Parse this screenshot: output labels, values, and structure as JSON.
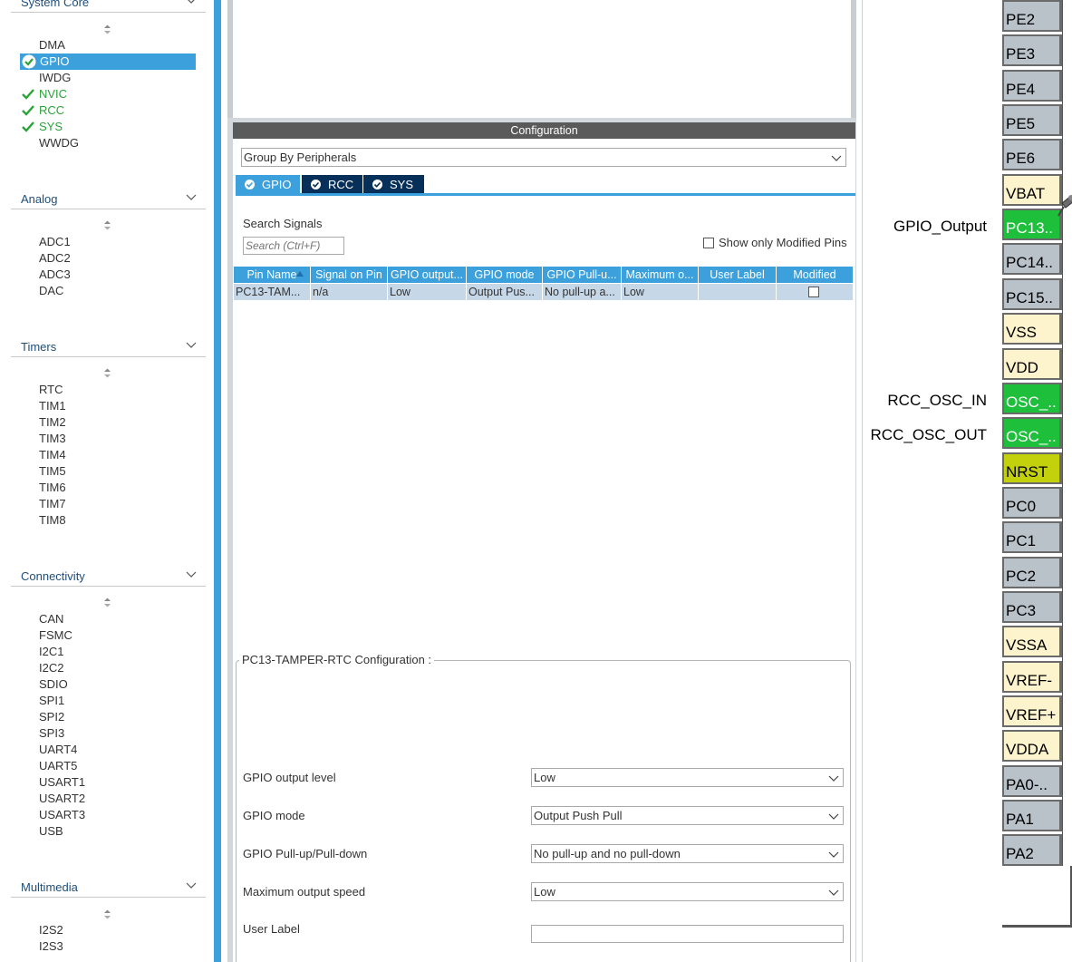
{
  "sidebar": {
    "categories": [
      {
        "title": "System Core",
        "items": [
          "DMA",
          "GPIO",
          "IWDG",
          "NVIC",
          "RCC",
          "SYS",
          "WWDG"
        ]
      },
      {
        "title": "Analog",
        "items": [
          "ADC1",
          "ADC2",
          "ADC3",
          "DAC"
        ]
      },
      {
        "title": "Timers",
        "items": [
          "RTC",
          "TIM1",
          "TIM2",
          "TIM3",
          "TIM4",
          "TIM5",
          "TIM6",
          "TIM7",
          "TIM8"
        ]
      },
      {
        "title": "Connectivity",
        "items": [
          "CAN",
          "FSMC",
          "I2C1",
          "I2C2",
          "SDIO",
          "SPI1",
          "SPI2",
          "SPI3",
          "UART4",
          "UART5",
          "USART1",
          "USART2",
          "USART3",
          "USB"
        ]
      },
      {
        "title": "Multimedia",
        "items": [
          "I2S2",
          "I2S3"
        ]
      }
    ],
    "selected_item": "GPIO",
    "checked_items": [
      "NVIC",
      "RCC",
      "SYS"
    ],
    "colors": {
      "accent": "#3ca0dc",
      "checked": "#2aa33a"
    }
  },
  "config": {
    "title": "Configuration",
    "group_by": "Group By Peripherals",
    "tabs": [
      {
        "label": "GPIO",
        "active": true
      },
      {
        "label": "RCC",
        "active": false
      },
      {
        "label": "SYS",
        "active": false
      }
    ],
    "search_label": "Search Signals",
    "search_placeholder": "Search (Ctrl+F)",
    "show_modified_label": "Show only Modified Pins",
    "table": {
      "headers": [
        "Pin Name",
        "Signal on Pin",
        "GPIO output...",
        "GPIO mode",
        "GPIO Pull-u...",
        "Maximum o...",
        "User Label",
        "Modified"
      ],
      "rows": [
        [
          "PC13-TAM...",
          "n/a",
          "Low",
          "Output Pus...",
          "No pull-up a...",
          "Low",
          "",
          ""
        ]
      ]
    },
    "pin_config": {
      "title": "PC13-TAMPER-RTC Configuration :",
      "fields": [
        {
          "label": "GPIO output level",
          "value": "Low"
        },
        {
          "label": "GPIO mode",
          "value": "Output Push Pull"
        },
        {
          "label": "GPIO Pull-up/Pull-down",
          "value": "No pull-up and no pull-down"
        },
        {
          "label": "Maximum output speed",
          "value": "Low"
        },
        {
          "label": "User Label",
          "value": ""
        }
      ]
    }
  },
  "chip": {
    "pins": [
      {
        "name": "PE2",
        "state": "gray"
      },
      {
        "name": "PE3",
        "state": "gray"
      },
      {
        "name": "PE4",
        "state": "gray"
      },
      {
        "name": "PE5",
        "state": "gray"
      },
      {
        "name": "PE6",
        "state": "gray"
      },
      {
        "name": "VBAT",
        "state": "power"
      },
      {
        "name": "PC13..",
        "state": "green",
        "signal": "GPIO_Output"
      },
      {
        "name": "PC14..",
        "state": "gray"
      },
      {
        "name": "PC15..",
        "state": "gray"
      },
      {
        "name": "VSS",
        "state": "power"
      },
      {
        "name": "VDD",
        "state": "power"
      },
      {
        "name": "OSC_..",
        "state": "green",
        "signal": "RCC_OSC_IN"
      },
      {
        "name": "OSC_..",
        "state": "green",
        "signal": "RCC_OSC_OUT"
      },
      {
        "name": "NRST",
        "state": "nrst"
      },
      {
        "name": "PC0",
        "state": "gray"
      },
      {
        "name": "PC1",
        "state": "gray"
      },
      {
        "name": "PC2",
        "state": "gray"
      },
      {
        "name": "PC3",
        "state": "gray"
      },
      {
        "name": "VSSA",
        "state": "power"
      },
      {
        "name": "VREF-",
        "state": "power"
      },
      {
        "name": "VREF+",
        "state": "power"
      },
      {
        "name": "VDDA",
        "state": "power"
      },
      {
        "name": "PA0-..",
        "state": "gray"
      },
      {
        "name": "PA1",
        "state": "gray"
      },
      {
        "name": "PA2",
        "state": "gray"
      }
    ]
  }
}
